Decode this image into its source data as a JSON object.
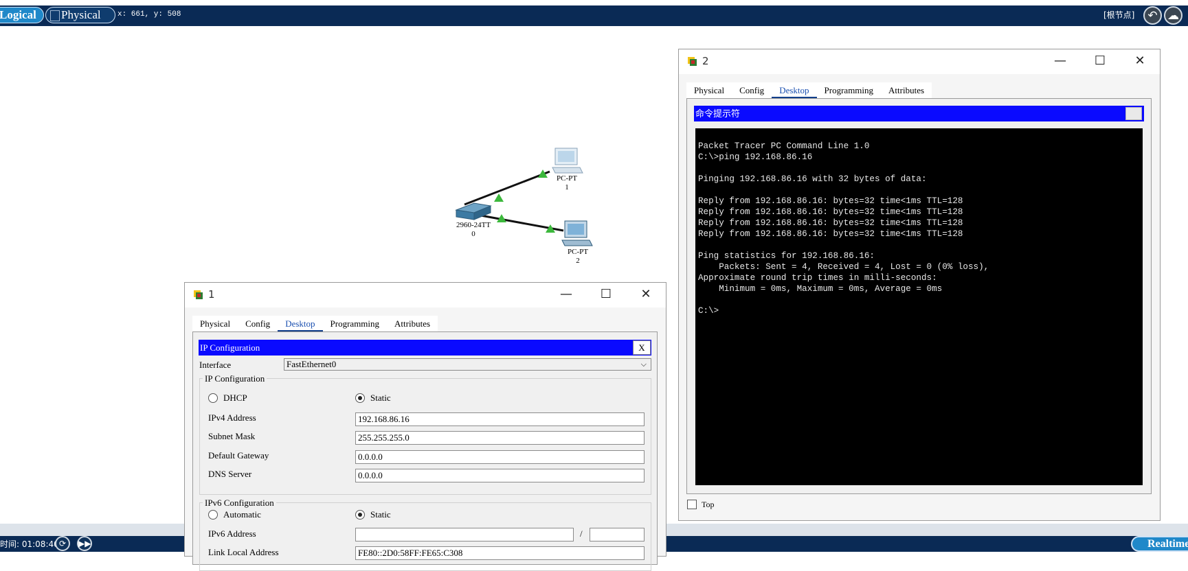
{
  "topbar": {
    "logical_label": "Logical",
    "physical_label": "Physical",
    "coords": "x: 661, y: 508",
    "root_node": "[根节点]"
  },
  "bottombar": {
    "timer": "时间: 01:08:40",
    "realtime_label": "Realtime"
  },
  "topology": {
    "switch": {
      "model": "2960-24TT",
      "index": "0"
    },
    "pc1": {
      "model": "PC-PT",
      "index": "1"
    },
    "pc2": {
      "model": "PC-PT",
      "index": "2"
    },
    "link_status_color": "#3cb83c"
  },
  "window1": {
    "title": "1",
    "tabs": [
      "Physical",
      "Config",
      "Desktop",
      "Programming",
      "Attributes"
    ],
    "active_tab": "Desktop",
    "app_title": "IP Configuration",
    "close_label": "X",
    "interface_label": "Interface",
    "interface_value": "FastEthernet0",
    "ipv4_group": "IP Configuration",
    "dhcp_label": "DHCP",
    "static_label": "Static",
    "ipv4_mode": "Static",
    "ipv4_address_label": "IPv4 Address",
    "ipv4_address": "192.168.86.16",
    "subnet_mask_label": "Subnet Mask",
    "subnet_mask": "255.255.255.0",
    "gateway_label": "Default Gateway",
    "gateway": "0.0.0.0",
    "dns_label": "DNS Server",
    "dns": "0.0.0.0",
    "ipv6_group": "IPv6 Configuration",
    "automatic_label": "Automatic",
    "static6_label": "Static",
    "ipv6_mode": "Static",
    "ipv6_address_label": "IPv6 Address",
    "ipv6_address": "",
    "prefix_separator": "/",
    "ipv6_prefix": "",
    "link_local_label": "Link Local Address",
    "link_local": "FE80::2D0:58FF:FE65:C308"
  },
  "window2": {
    "title": "2",
    "tabs": [
      "Physical",
      "Config",
      "Desktop",
      "Programming",
      "Attributes"
    ],
    "active_tab": "Desktop",
    "app_title": "命令提示符",
    "terminal": "Packet Tracer PC Command Line 1.0\nC:\\>ping 192.168.86.16\n\nPinging 192.168.86.16 with 32 bytes of data:\n\nReply from 192.168.86.16: bytes=32 time<1ms TTL=128\nReply from 192.168.86.16: bytes=32 time<1ms TTL=128\nReply from 192.168.86.16: bytes=32 time<1ms TTL=128\nReply from 192.168.86.16: bytes=32 time<1ms TTL=128\n\nPing statistics for 192.168.86.16:\n    Packets: Sent = 4, Received = 4, Lost = 0 (0% loss),\nApproximate round trip times in milli-seconds:\n    Minimum = 0ms, Maximum = 0ms, Average = 0ms\n\nC:\\>",
    "top_label": "Top",
    "top_checked": false
  },
  "colors": {
    "topbar": "#0a2a55",
    "accent_blue": "#0a0aff",
    "tab_active": "#123f8c",
    "terminal_bg": "#000000"
  }
}
